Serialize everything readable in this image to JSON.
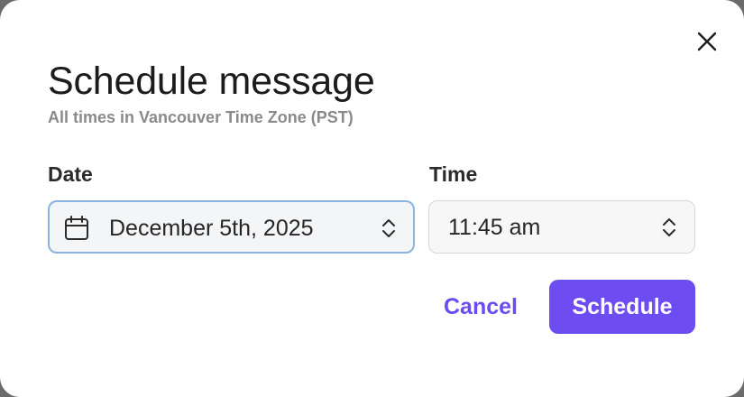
{
  "dialog": {
    "title": "Schedule message",
    "subtitle": "All times in Vancouver Time Zone (PST)",
    "close_icon": "close-icon"
  },
  "date_field": {
    "label": "Date",
    "value": "December 5th, 2025",
    "icon": "calendar-icon",
    "focused": true
  },
  "time_field": {
    "label": "Time",
    "value": "11:45 am"
  },
  "actions": {
    "cancel_label": "Cancel",
    "schedule_label": "Schedule"
  },
  "colors": {
    "accent": "#6d4cf2",
    "focus_ring": "#8ab4de",
    "subtitle": "#8a8a8a"
  }
}
